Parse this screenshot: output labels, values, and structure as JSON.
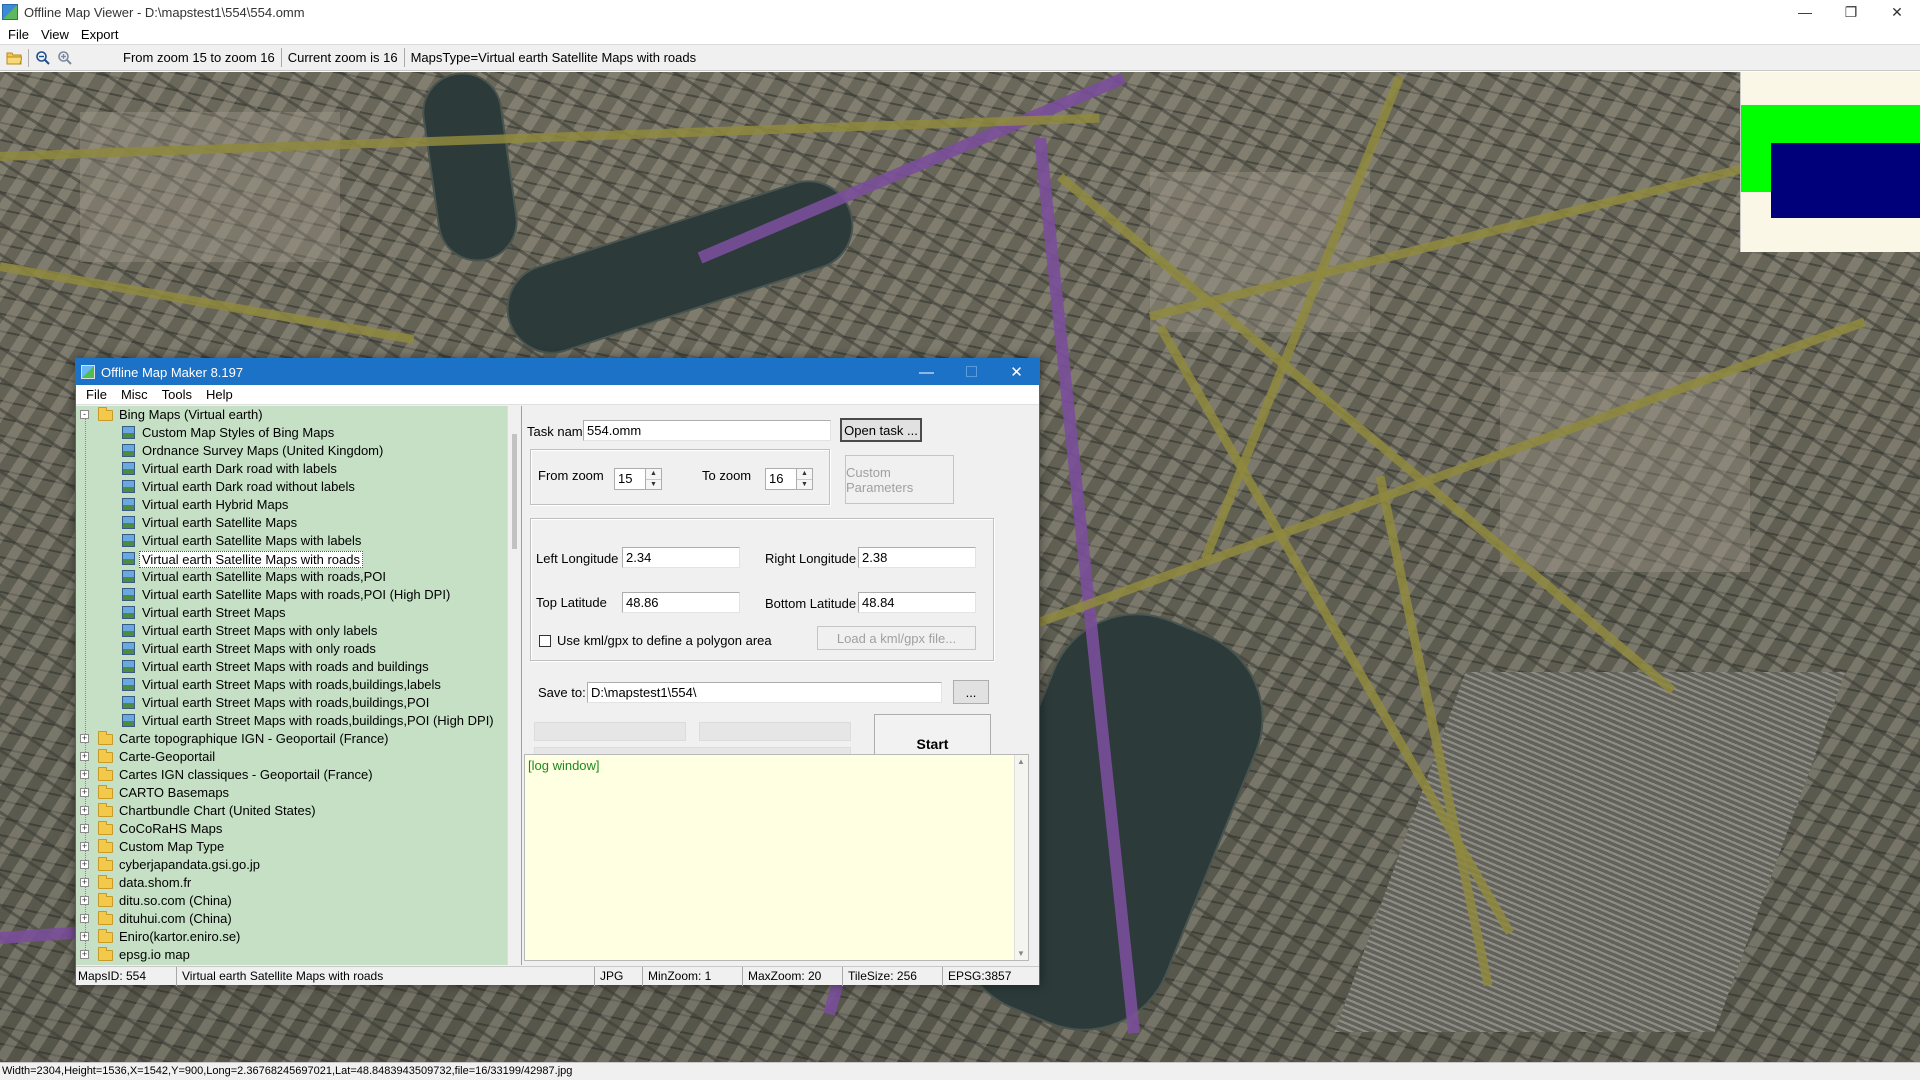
{
  "main_window": {
    "title": "Offline Map Viewer - D:\\mapstest1\\554\\554.omm",
    "menu": [
      "File",
      "View",
      "Export"
    ],
    "toolbar": {
      "zoom_range": "From zoom 15 to zoom 16",
      "current_zoom": "Current zoom is 16",
      "maps_type": "MapsType=Virtual earth Satellite Maps with roads"
    },
    "status": "Width=2304,Height=1536,X=1542,Y=900,Long=2.36768245697021,Lat=48.8483943509732,file=16/33199/42987.jpg",
    "overview_colors": {
      "background": "#fbf7e6",
      "extent": "#00ff00",
      "view": "#00007a"
    }
  },
  "dialog": {
    "title": "Offline Map Maker 8.197",
    "menu": [
      "File",
      "Misc",
      "Tools",
      "Help"
    ],
    "tree": {
      "root": "Bing Maps (Virtual earth)",
      "children": [
        "Custom Map Styles of Bing Maps",
        "Ordnance Survey Maps (United Kingdom)",
        "Virtual earth Dark road with labels",
        "Virtual earth Dark road without labels",
        "Virtual earth Hybrid Maps",
        "Virtual earth Satellite Maps",
        "Virtual earth Satellite Maps with labels",
        "Virtual earth Satellite Maps with roads",
        "Virtual earth Satellite Maps with roads,POI",
        "Virtual earth Satellite Maps with roads,POI (High DPI)",
        "Virtual earth Street Maps",
        "Virtual earth Street Maps with only labels",
        "Virtual earth Street Maps with only roads",
        "Virtual earth Street Maps with roads and buildings",
        "Virtual earth Street Maps with roads,buildings,labels",
        "Virtual earth Street Maps with roads,buildings,POI",
        "Virtual earth Street Maps with roads,buildings,POI (High DPI)"
      ],
      "selected": "Virtual earth Satellite Maps with roads",
      "groups": [
        "Carte topographique IGN - Geoportail (France)",
        "Carte-Geoportail",
        "Cartes IGN classiques - Geoportail (France)",
        "CARTO Basemaps",
        "Chartbundle Chart (United States)",
        "CoCoRaHS Maps",
        "Custom Map Type",
        "cyberjapandata.gsi.go.jp",
        "data.shom.fr",
        "ditu.so.com (China)",
        "dituhui.com (China)",
        "Eniro(kartor.eniro.se)",
        "epsg.io map"
      ]
    },
    "form": {
      "task_name_label": "Task name",
      "task_name": "554.omm",
      "open_task": "Open task ...",
      "from_zoom_label": "From zoom",
      "from_zoom": "15",
      "to_zoom_label": "To zoom",
      "to_zoom": "16",
      "custom_params": "Custom Parameters",
      "left_lon_label": "Left Longitude",
      "left_lon": "2.34",
      "right_lon_label": "Right Longitude",
      "right_lon": "2.38",
      "top_lat_label": "Top Latitude",
      "top_lat": "48.86",
      "bottom_lat_label": "Bottom Latitude",
      "bottom_lat": "48.84",
      "kml_label": "Use kml/gpx to define a polygon area",
      "load_kml": "Load a kml/gpx file...",
      "save_to_label": "Save to:",
      "save_to": "D:\\mapstest1\\554\\",
      "browse": "...",
      "start": "Start"
    },
    "log": "[log window]",
    "status": {
      "maps_id": "MapsID: 554",
      "maps_name": "Virtual earth Satellite Maps with roads",
      "format": "JPG",
      "min_zoom": "MinZoom: 1",
      "max_zoom": "MaxZoom: 20",
      "tile_size": "TileSize: 256",
      "epsg": "EPSG:3857"
    }
  }
}
